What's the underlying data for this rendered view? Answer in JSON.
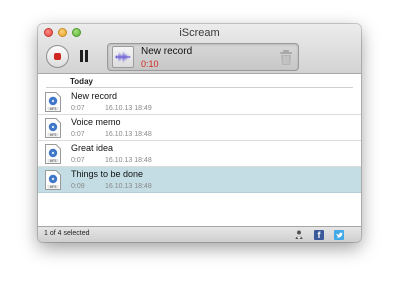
{
  "window": {
    "title": "iScream"
  },
  "toolbar": {
    "stop_icon": "stop-record-icon",
    "pause_icon": "pause-icon",
    "current": {
      "name": "New record",
      "elapsed": "0:10",
      "elapsed_color": "#d0271e"
    },
    "trash_icon": "trash-icon"
  },
  "list": {
    "section": "Today",
    "items": [
      {
        "name": "New record",
        "duration": "0:07",
        "date": "16.10.13 18:49",
        "selected": false
      },
      {
        "name": "Voice memo",
        "duration": "0:07",
        "date": "16.10.13 18:48",
        "selected": false
      },
      {
        "name": "Great idea",
        "duration": "0:07",
        "date": "16.10.13 18:48",
        "selected": false
      },
      {
        "name": "Things to be done",
        "duration": "0:09",
        "date": "16.10.13 18:48",
        "selected": true
      }
    ],
    "selection_color": "#c4dde4"
  },
  "statusbar": {
    "text": "1 of 4 selected",
    "icons": [
      "share-icon",
      "facebook-icon",
      "twitter-icon"
    ]
  }
}
